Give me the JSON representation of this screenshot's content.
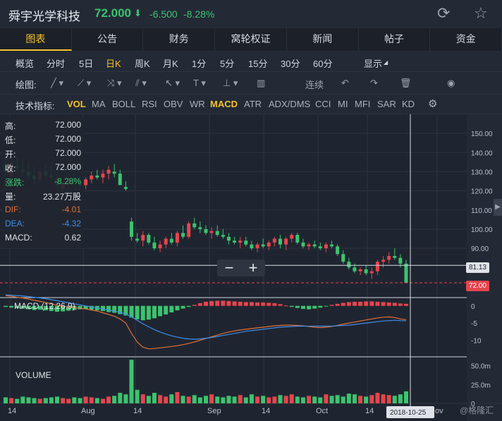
{
  "header": {
    "name": "舜宇光学科技",
    "price": "72.000",
    "arrow": "⬇",
    "change": "-6.500",
    "pct": "-8.28%"
  },
  "tabs": [
    "图表",
    "公告",
    "财务",
    "窝轮权证",
    "新闻",
    "帖子",
    "资金"
  ],
  "periods": [
    "概览",
    "分时",
    "5日",
    "日K",
    "周K",
    "月K",
    "1分",
    "5分",
    "15分",
    "30分",
    "60分",
    "显示"
  ],
  "draw": {
    "label": "绘图:",
    "connect": "连续"
  },
  "indicators": {
    "label": "技术指标:",
    "items": [
      "VOL",
      "MA",
      "BOLL",
      "RSI",
      "OBV",
      "WR",
      "MACD",
      "ATR",
      "ADX/DMS",
      "CCI",
      "MI",
      "MFI",
      "SAR",
      "KD"
    ]
  },
  "info": [
    {
      "k": "高:",
      "v": "72.000",
      "c": "#dfe4ea"
    },
    {
      "k": "低:",
      "v": "72.000",
      "c": "#dfe4ea"
    },
    {
      "k": "开:",
      "v": "72.000",
      "c": "#dfe4ea"
    },
    {
      "k": "收:",
      "v": "72.000",
      "c": "#dfe4ea"
    },
    {
      "k": "涨跌:",
      "v": "-8.28%",
      "c": "#3cc36e"
    },
    {
      "k": "量:",
      "v": "23.27万股",
      "c": "#dfe4ea"
    },
    {
      "k": "DIF:",
      "v": "-4.01",
      "c": "#e0703a"
    },
    {
      "k": "DEA:",
      "v": "-4.32",
      "c": "#3e8ee8"
    },
    {
      "k": "MACD:",
      "v": "0.62",
      "c": "#dfe4ea"
    }
  ],
  "price_axis": [
    "150.00",
    "140.00",
    "130.00",
    "120.00",
    "110.00",
    "100.00",
    "90.00"
  ],
  "hover_price": "81.13",
  "last_price": "72.00",
  "macd_label": "MACD (12,26,9)",
  "macd_axis": [
    "0",
    "-5",
    "-10"
  ],
  "volume_label": "VOLUME",
  "volume_axis": [
    "50.0m",
    "25.0m",
    "0"
  ],
  "x_axis": [
    "14",
    "Aug",
    "14",
    "Sep",
    "14",
    "Oct",
    "14",
    "ov"
  ],
  "date_tip": "2018-10-25",
  "watermark": "@格隆汇",
  "colors": {
    "up": "#e5454d",
    "down": "#3cc36e",
    "dif": "#e0703a",
    "dea": "#3e8ee8",
    "accent": "#f5c22b"
  },
  "chart_data": {
    "type": "candlestick",
    "ylim": [
      65,
      160
    ],
    "candles": [
      [
        134,
        140,
        128,
        130
      ],
      [
        128,
        136,
        126,
        135
      ],
      [
        133,
        138,
        130,
        132
      ],
      [
        131,
        137,
        128,
        130
      ],
      [
        130,
        135,
        126,
        128
      ],
      [
        128,
        133,
        124,
        126
      ],
      [
        126,
        132,
        124,
        130
      ],
      [
        130,
        134,
        127,
        128
      ],
      [
        128,
        133,
        125,
        127
      ],
      [
        126,
        129,
        122,
        123
      ],
      [
        121,
        126,
        119,
        124
      ],
      [
        124,
        128,
        122,
        126
      ],
      [
        126,
        130,
        123,
        125
      ],
      [
        125,
        128,
        121,
        123
      ],
      [
        123,
        127,
        121,
        126
      ],
      [
        126,
        130,
        124,
        128
      ],
      [
        128,
        131,
        126,
        127
      ],
      [
        127,
        131,
        124,
        129
      ],
      [
        129,
        133,
        126,
        131
      ],
      [
        130,
        134,
        127,
        129
      ],
      [
        129,
        131,
        123,
        123
      ],
      [
        122,
        125,
        120,
        121
      ],
      [
        104,
        106,
        94,
        96
      ],
      [
        95,
        98,
        93,
        94
      ],
      [
        94,
        99,
        91,
        97
      ],
      [
        97,
        98,
        92,
        93
      ],
      [
        93,
        96,
        89,
        90
      ],
      [
        90,
        94,
        88,
        92
      ],
      [
        92,
        96,
        90,
        95
      ],
      [
        95,
        98,
        92,
        93
      ],
      [
        93,
        99,
        91,
        98
      ],
      [
        98,
        102,
        95,
        96
      ],
      [
        96,
        104,
        95,
        103
      ],
      [
        103,
        106,
        100,
        101
      ],
      [
        101,
        104,
        98,
        100
      ],
      [
        100,
        102,
        97,
        98
      ],
      [
        98,
        101,
        95,
        99
      ],
      [
        99,
        102,
        96,
        97
      ],
      [
        97,
        100,
        95,
        96
      ],
      [
        96,
        98,
        92,
        94
      ],
      [
        94,
        96,
        92,
        93
      ],
      [
        93,
        96,
        90,
        94
      ],
      [
        94,
        96,
        91,
        92
      ],
      [
        92,
        94,
        89,
        90
      ],
      [
        90,
        93,
        88,
        92
      ],
      [
        92,
        95,
        90,
        91
      ],
      [
        91,
        94,
        89,
        93
      ],
      [
        93,
        96,
        91,
        95
      ],
      [
        95,
        97,
        90,
        92
      ],
      [
        92,
        96,
        89,
        95
      ],
      [
        95,
        98,
        93,
        97
      ],
      [
        97,
        98,
        92,
        93
      ],
      [
        93,
        95,
        90,
        91
      ],
      [
        91,
        93,
        89,
        92
      ],
      [
        92,
        94,
        90,
        91
      ],
      [
        91,
        93,
        89,
        90
      ],
      [
        90,
        93,
        88,
        92
      ],
      [
        92,
        94,
        90,
        91
      ],
      [
        91,
        92,
        86,
        87
      ],
      [
        87,
        89,
        82,
        83
      ],
      [
        83,
        85,
        79,
        80
      ],
      [
        80,
        82,
        77,
        78
      ],
      [
        78,
        80,
        76,
        79
      ],
      [
        79,
        81,
        76,
        77
      ],
      [
        77,
        80,
        74,
        78
      ],
      [
        78,
        84,
        76,
        83
      ],
      [
        83,
        86,
        80,
        84
      ],
      [
        84,
        88,
        82,
        86
      ],
      [
        86,
        90,
        84,
        85
      ],
      [
        85,
        87,
        80,
        82
      ],
      [
        82,
        84,
        72,
        72
      ]
    ],
    "macd": {
      "hist": [
        -0.3,
        -0.5,
        -0.6,
        -0.8,
        -1.0,
        -1.2,
        -1.1,
        -1.3,
        -1.5,
        -1.7,
        -1.6,
        -1.4,
        -1.2,
        -1.0,
        -0.9,
        -1.1,
        -1.3,
        -1.5,
        -1.8,
        -2.0,
        -2.4,
        -2.8,
        -3.4,
        -3.9,
        -4.2,
        -4.0,
        -3.6,
        -3.0,
        -2.5,
        -1.9,
        -1.3,
        -0.8,
        -0.3,
        0.3,
        0.8,
        1.2,
        1.4,
        1.5,
        1.5,
        1.4,
        1.3,
        1.2,
        1.1,
        1.1,
        1.0,
        1.0,
        0.9,
        0.8,
        0.5,
        0.1,
        -0.3,
        -0.6,
        -0.9,
        -1.0,
        -0.8,
        -0.5,
        -0.1,
        0.3,
        0.6,
        0.9,
        1.1,
        1.2,
        1.2,
        1.3,
        1.3,
        1.2,
        1.1,
        1.0,
        0.9,
        0.7,
        0.6
      ],
      "dif": [
        3,
        2.8,
        2.5,
        2.3,
        2,
        1.6,
        1.3,
        1,
        0.6,
        0.2,
        -0.1,
        -0.3,
        -0.5,
        -0.7,
        -0.9,
        -1.2,
        -1.5,
        -2,
        -2.5,
        -3,
        -3.8,
        -5,
        -8,
        -10.5,
        -12,
        -12.5,
        -12.4,
        -12.2,
        -12,
        -11.8,
        -11.6,
        -11.3,
        -10.9,
        -10.5,
        -10,
        -9.5,
        -9,
        -8.5,
        -8,
        -7.6,
        -7.3,
        -7,
        -6.8,
        -6.6,
        -6.4,
        -6.2,
        -6,
        -5.8,
        -5.7,
        -5.6,
        -5.6,
        -5.7,
        -5.8,
        -6,
        -6.2,
        -6.3,
        -6.2,
        -6,
        -5.7,
        -5.3,
        -5,
        -4.7,
        -4.4,
        -4.1,
        -3.8,
        -3.5,
        -3.3,
        -3.2,
        -3.4,
        -3.8,
        -4.01
      ],
      "dea": [
        3.2,
        3.1,
        3,
        2.9,
        2.7,
        2.5,
        2.3,
        2.1,
        1.8,
        1.5,
        1.2,
        0.9,
        0.6,
        0.3,
        0,
        -0.3,
        -0.6,
        -0.9,
        -1.2,
        -1.5,
        -1.9,
        -2.4,
        -3.2,
        -4.2,
        -5.2,
        -6.1,
        -6.9,
        -7.6,
        -8.2,
        -8.7,
        -9.1,
        -9.4,
        -9.6,
        -9.7,
        -9.6,
        -9.4,
        -9.2,
        -8.9,
        -8.6,
        -8.3,
        -8,
        -7.7,
        -7.4,
        -7.2,
        -7,
        -6.8,
        -6.6,
        -6.4,
        -6.2,
        -6.1,
        -6,
        -5.9,
        -5.9,
        -5.9,
        -5.9,
        -5.9,
        -5.9,
        -5.9,
        -5.8,
        -5.7,
        -5.6,
        -5.4,
        -5.2,
        -5,
        -4.8,
        -4.6,
        -4.4,
        -4.3,
        -4.2,
        -4.3,
        -4.32
      ],
      "ylim": [
        -14,
        2
      ]
    },
    "volume": {
      "ylim": [
        0,
        60
      ],
      "values": [
        8,
        7,
        6,
        9,
        8,
        7,
        6,
        7,
        8,
        9,
        7,
        6,
        8,
        7,
        9,
        8,
        7,
        6,
        9,
        10,
        14,
        12,
        58,
        18,
        12,
        10,
        14,
        11,
        9,
        12,
        15,
        10,
        9,
        11,
        8,
        10,
        12,
        9,
        8,
        10,
        9,
        11,
        8,
        12,
        9,
        10,
        8,
        9,
        11,
        10,
        12,
        9,
        8,
        10,
        9,
        8,
        12,
        10,
        11,
        9,
        13,
        12,
        10,
        9,
        11,
        14,
        12,
        11,
        10,
        12,
        16
      ]
    }
  }
}
